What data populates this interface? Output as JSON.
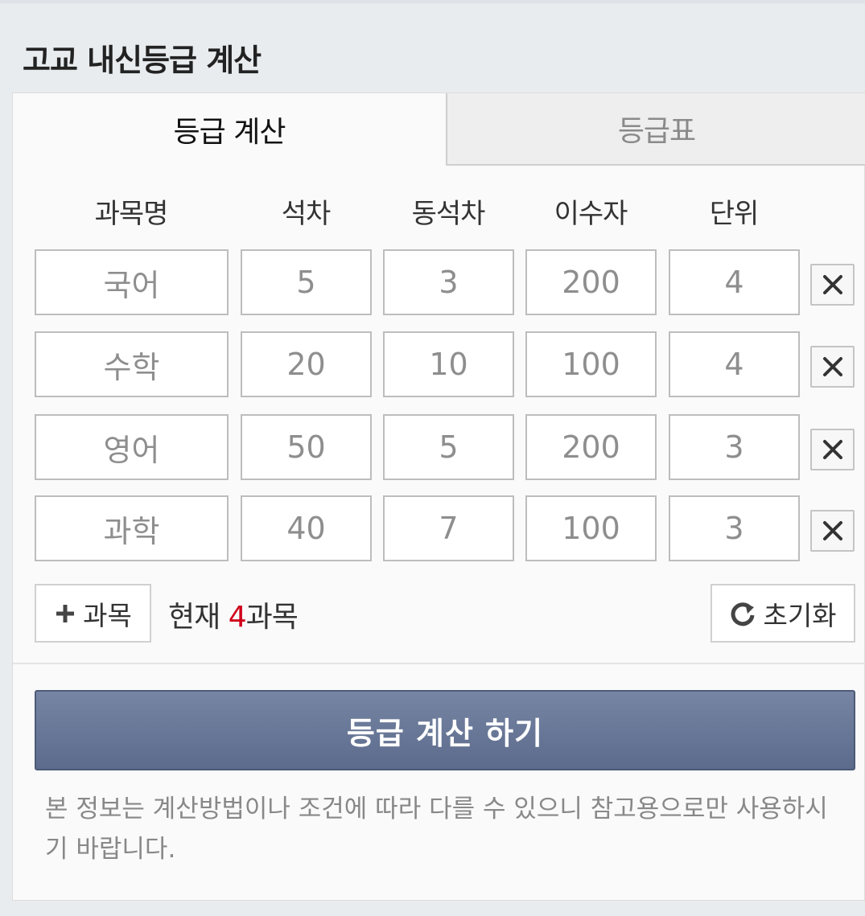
{
  "page_title": "고교 내신등급 계산",
  "tabs": [
    {
      "label": "등급 계산",
      "active": true
    },
    {
      "label": "등급표",
      "active": false
    }
  ],
  "columns": [
    "과목명",
    "석차",
    "동석차",
    "이수자",
    "단위"
  ],
  "rows": [
    {
      "subject": "국어",
      "rank": "5",
      "tie": "3",
      "students": "200",
      "units": "4"
    },
    {
      "subject": "수학",
      "rank": "20",
      "tie": "10",
      "students": "100",
      "units": "4"
    },
    {
      "subject": "영어",
      "rank": "50",
      "tie": "5",
      "students": "200",
      "units": "3"
    },
    {
      "subject": "과학",
      "rank": "40",
      "tie": "7",
      "students": "100",
      "units": "3"
    }
  ],
  "add_button": {
    "icon": "plus-icon",
    "label": "과목"
  },
  "count": {
    "prefix": "현재 ",
    "number": "4",
    "suffix": "과목"
  },
  "reset_button": {
    "icon": "refresh-icon",
    "label": "초기화"
  },
  "calc_button": {
    "label": "등급 계산 하기"
  },
  "notice": "본 정보는 계산방법이나 조건에 따라 다를 수 있으니 참고용으로만 사용하시기 바랍니다.",
  "colors": {
    "accent_button": "#6b7898",
    "count_highlight": "#d0021b"
  }
}
